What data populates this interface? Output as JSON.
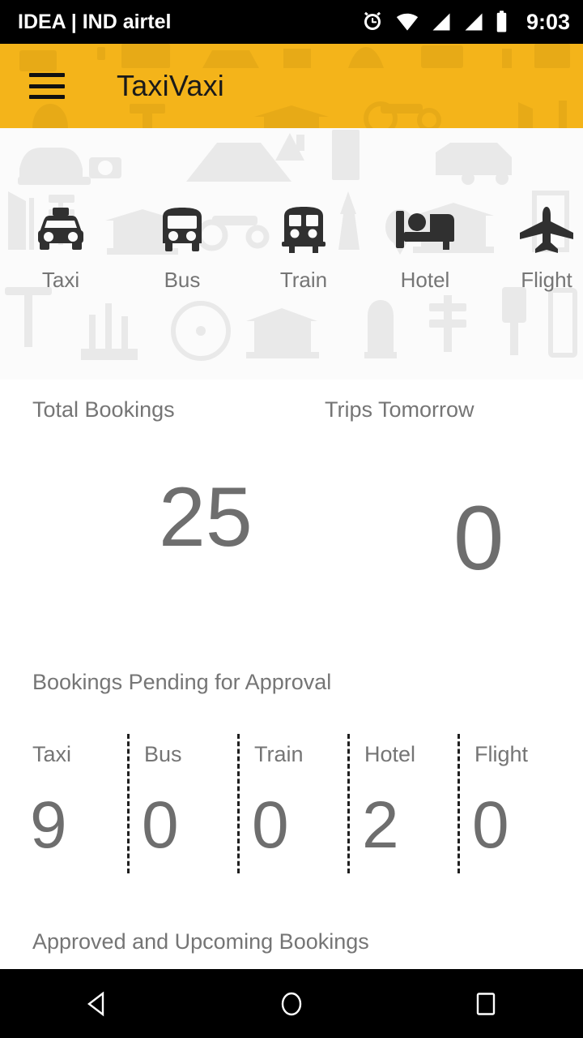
{
  "status_bar": {
    "carrier": "IDEA | IND airtel",
    "clock": "9:03",
    "icons": [
      "alarm-icon",
      "wifi-icon",
      "signal-icon-1",
      "signal-icon-2",
      "battery-icon"
    ],
    "background": "#000000",
    "foreground": "#ffffff"
  },
  "app_bar": {
    "menu_icon": "hamburger-menu-icon",
    "title": "TaxiVaxi",
    "background": "#F4B41A",
    "title_color": "#1a1a1a"
  },
  "hero": {
    "background": "#fbfbfb",
    "watermark": "travel-landmarks-pattern",
    "modes": [
      {
        "label": "Taxi",
        "icon": "taxi-icon"
      },
      {
        "label": "Bus",
        "icon": "bus-icon"
      },
      {
        "label": "Train",
        "icon": "train-icon"
      },
      {
        "label": "Hotel",
        "icon": "hotel-bed-icon"
      },
      {
        "label": "Flight",
        "icon": "airplane-icon"
      }
    ]
  },
  "stats": {
    "total_bookings": {
      "label": "Total Bookings",
      "value": "25"
    },
    "trips_tomorrow": {
      "label": "Trips Tomorrow",
      "value": "0"
    },
    "value_color": "#6e6e6e",
    "label_color": "#757575"
  },
  "pending": {
    "title": "Bookings Pending for Approval",
    "columns": [
      {
        "name": "Taxi",
        "count": "9"
      },
      {
        "name": "Bus",
        "count": "0"
      },
      {
        "name": "Train",
        "count": "0"
      },
      {
        "name": "Hotel",
        "count": "2"
      },
      {
        "name": "Flight",
        "count": "0"
      }
    ],
    "divider_style": "dashed",
    "divider_color": "#1f1f1f"
  },
  "upcoming": {
    "title": "Approved and Upcoming Bookings"
  },
  "nav_bar": {
    "background": "#000000",
    "buttons": [
      {
        "name": "back-button",
        "icon": "triangle-left-icon"
      },
      {
        "name": "home-button",
        "icon": "circle-icon"
      },
      {
        "name": "recents-button",
        "icon": "square-icon"
      }
    ]
  }
}
